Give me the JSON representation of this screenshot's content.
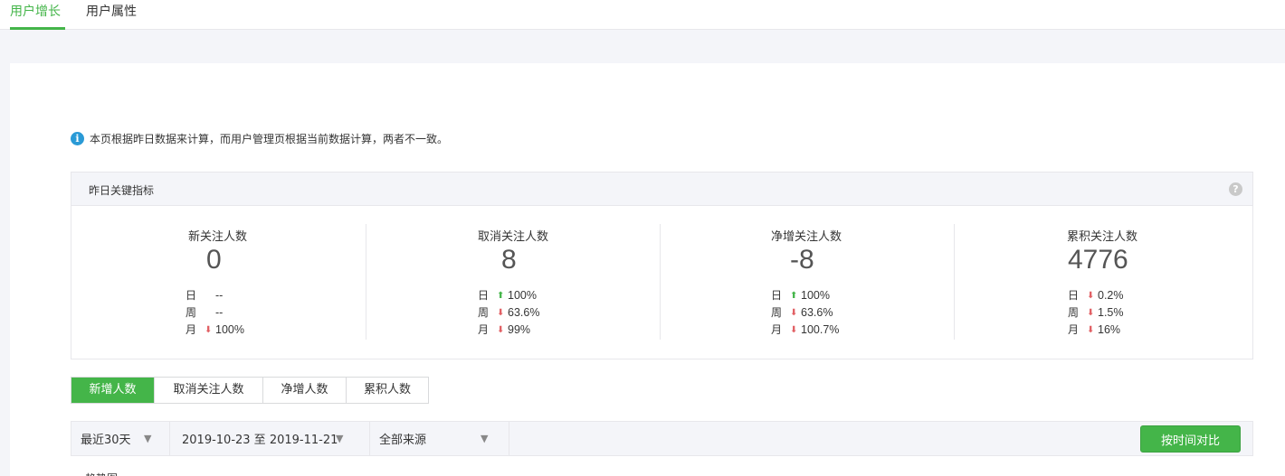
{
  "tabs": [
    {
      "label": "用户增长",
      "active": true
    },
    {
      "label": "用户属性",
      "active": false
    }
  ],
  "notice": "本页根据昨日数据来计算，而用户管理页根据当前数据计算，两者不一致。",
  "kpi": {
    "title": "昨日关键指标",
    "help_icon": "?",
    "columns": [
      {
        "label": "新关注人数",
        "value": "0",
        "rows": [
          {
            "period": "日",
            "dir": "none",
            "value": "--"
          },
          {
            "period": "周",
            "dir": "none",
            "value": "--"
          },
          {
            "period": "月",
            "dir": "down",
            "value": "100%"
          }
        ]
      },
      {
        "label": "取消关注人数",
        "value": "8",
        "rows": [
          {
            "period": "日",
            "dir": "up",
            "value": "100%"
          },
          {
            "period": "周",
            "dir": "down",
            "value": "63.6%"
          },
          {
            "period": "月",
            "dir": "down",
            "value": "99%"
          }
        ]
      },
      {
        "label": "净增关注人数",
        "value": "-8",
        "rows": [
          {
            "period": "日",
            "dir": "up",
            "value": "100%"
          },
          {
            "period": "周",
            "dir": "down",
            "value": "63.6%"
          },
          {
            "period": "月",
            "dir": "down",
            "value": "100.7%"
          }
        ]
      },
      {
        "label": "累积关注人数",
        "value": "4776",
        "rows": [
          {
            "period": "日",
            "dir": "down",
            "value": "0.2%"
          },
          {
            "period": "周",
            "dir": "down",
            "value": "1.5%"
          },
          {
            "period": "月",
            "dir": "down",
            "value": "16%"
          }
        ]
      }
    ]
  },
  "metric_tabs": [
    {
      "label": "新增人数",
      "active": true
    },
    {
      "label": "取消关注人数",
      "active": false
    },
    {
      "label": "净增人数",
      "active": false
    },
    {
      "label": "累积人数",
      "active": false
    }
  ],
  "filters": {
    "range": "最近30天",
    "dates": "2019-10-23 至 2019-11-21",
    "source": "全部来源",
    "compare_label": "按时间对比",
    "caret": "▼"
  },
  "section_title": "趋势图",
  "colors": {
    "accent": "#44b549",
    "down": "#e15f63",
    "info": "#2a9ad6"
  }
}
